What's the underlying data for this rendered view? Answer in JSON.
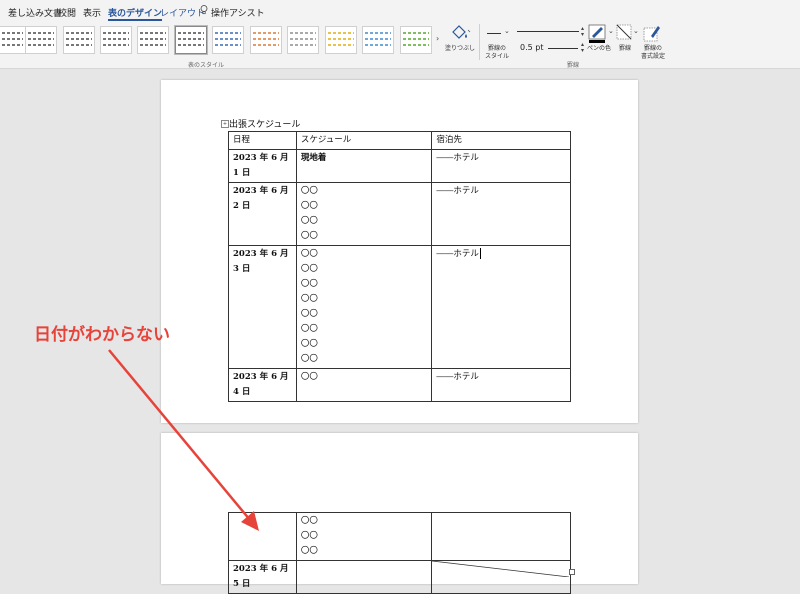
{
  "ribbon": {
    "tabs": [
      {
        "label": "差し込み文書"
      },
      {
        "label": "校閲"
      },
      {
        "label": "表示"
      },
      {
        "label": "表のデザイン"
      },
      {
        "label": "レイアウト"
      },
      {
        "label": "操作アシスト"
      }
    ],
    "table_styles_group_label": "表のスタイル",
    "shading_label": "塗りつぶし",
    "border_style_label": "罫線の\nスタイル",
    "pen_weight": "0.5 pt",
    "pen_color_label": "ペンの色",
    "borders_label": "罫線",
    "border_painter_label": "罫線の\n書式設定",
    "borders_group_label": "罫線",
    "colors": {
      "active_tab": "#2b579a",
      "annotation": "#e6433a"
    }
  },
  "document": {
    "page1": {
      "title": "出張スケジュール",
      "header": [
        "日程",
        "スケジュール",
        "宿泊先"
      ],
      "rows": [
        {
          "date": "2023 年 6 月 1 日",
          "items": [
            "現地着"
          ],
          "hotel": "――ホテル"
        },
        {
          "date": "2023 年 6 月 2 日",
          "items": [
            "〇〇",
            "〇〇",
            "〇〇",
            "〇〇"
          ],
          "hotel": "――ホテル"
        },
        {
          "date": "2023 年 6 月 3 日",
          "items": [
            "〇〇",
            "〇〇",
            "〇〇",
            "〇〇",
            "〇〇",
            "〇〇",
            "〇〇",
            "〇〇"
          ],
          "hotel": "――ホテル"
        },
        {
          "date": "2023 年 6 月 4 日",
          "items": [
            "〇〇"
          ],
          "hotel": "――ホテル"
        }
      ]
    },
    "page2": {
      "rows": [
        {
          "date": "",
          "items": [
            "〇〇",
            "〇〇",
            "〇〇"
          ],
          "hotel": ""
        },
        {
          "date": "2023 年 6 月 5 日",
          "items": [
            ""
          ],
          "hotel": ""
        }
      ]
    }
  },
  "annotation": {
    "text": "日付がわからない"
  }
}
